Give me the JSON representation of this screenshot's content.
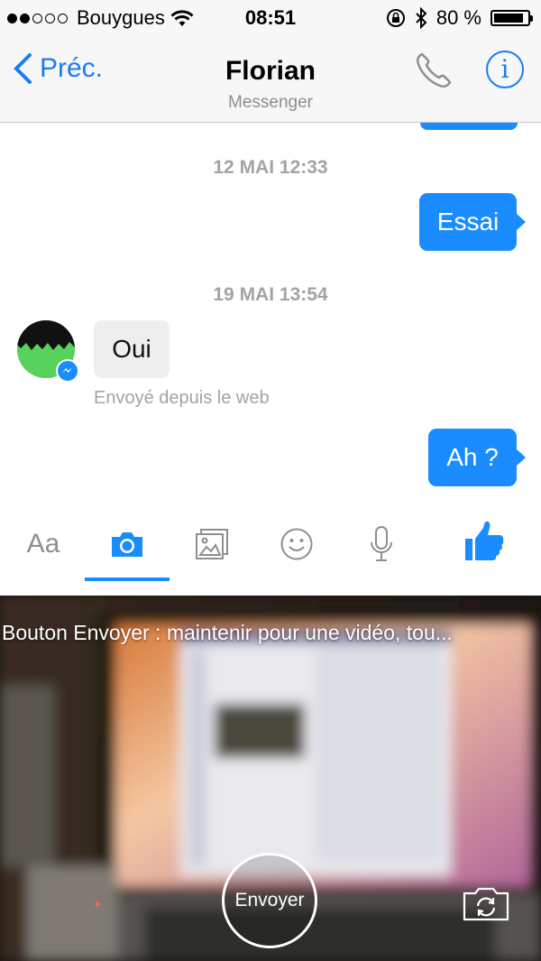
{
  "status": {
    "carrier": "Bouygues",
    "time": "08:51",
    "battery": "80 %",
    "signal_bars_filled": 2,
    "signal_bars_total": 5,
    "battery_level": 0.8
  },
  "nav": {
    "back_label": "Préc.",
    "title": "Florian",
    "subtitle": "Messenger"
  },
  "messages": {
    "timestamp_1": "12 MAI 12:33",
    "out_1": "Essai",
    "timestamp_2": "19 MAI 13:54",
    "in_1": "Oui",
    "in_1_note": "Envoyé depuis le web",
    "out_2": "Ah ?"
  },
  "toolbar": {
    "text_tab_label": "Aa",
    "active_tab": "camera"
  },
  "camera": {
    "hint": "Bouton Envoyer : maintenir pour une vidéo, tou...",
    "send_label": "Envoyer"
  },
  "colors": {
    "accent": "#1a8cff",
    "bubble_incoming": "#eeeeef",
    "timestamp": "#a3a3a8"
  }
}
